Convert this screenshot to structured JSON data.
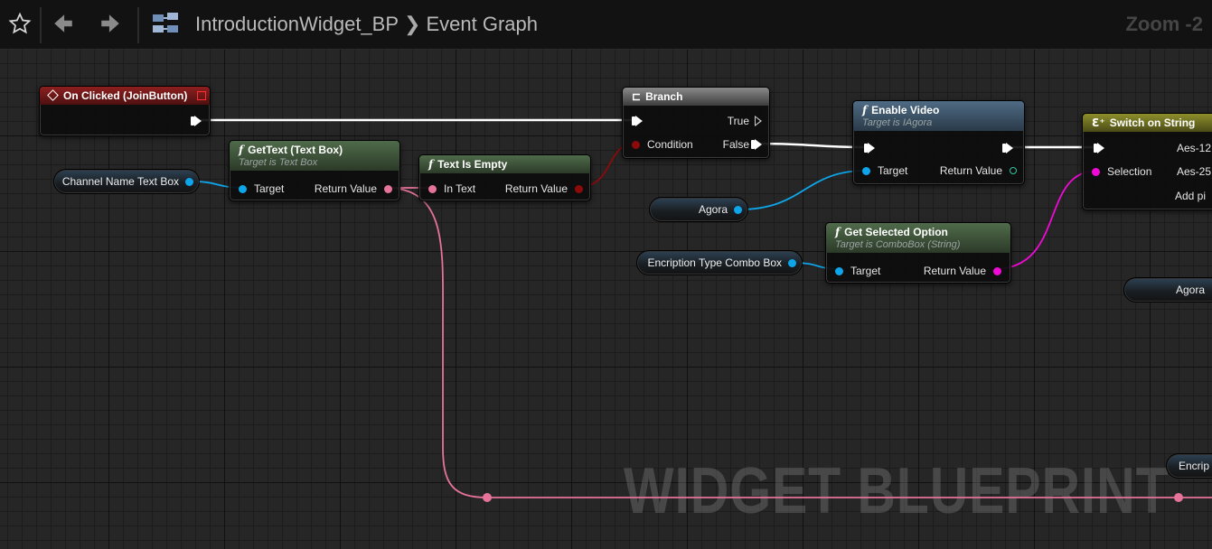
{
  "toolbar": {
    "breadcrumb_parent": "IntroductionWidget_BP",
    "breadcrumb_current": "Event Graph",
    "zoom": "Zoom -2"
  },
  "watermark": "WIDGET BLUEPRINT",
  "nodes": {
    "on_clicked": {
      "title": "On Clicked (JoinButton)"
    },
    "get_text": {
      "title": "GetText (Text Box)",
      "subtitle": "Target is Text Box",
      "pin_target": "Target",
      "pin_return": "Return Value"
    },
    "text_is_empty": {
      "title": "Text Is Empty",
      "pin_in": "In Text",
      "pin_return": "Return Value"
    },
    "branch": {
      "title": "Branch",
      "pin_condition": "Condition",
      "pin_true": "True",
      "pin_false": "False"
    },
    "enable_video": {
      "title": "Enable Video",
      "subtitle": "Target is IAgora",
      "pin_target": "Target",
      "pin_return": "Return Value"
    },
    "get_selected_option": {
      "title": "Get Selected Option",
      "subtitle": "Target is ComboBox (String)",
      "pin_target": "Target",
      "pin_return": "Return Value"
    },
    "switch_on_string": {
      "title": "Switch on String",
      "pin_selection": "Selection",
      "pin_out1": "Aes-12",
      "pin_out2": "Aes-25",
      "add_pin": "Add pi"
    }
  },
  "variables": {
    "channel_name_text_box": "Channel Name Text Box",
    "agora": "Agora",
    "encription_type_combo_box": "Encription Type Combo Box",
    "agora_right": "Agora",
    "encrip_partial": "Encrip"
  },
  "colors": {
    "object_pin": "#0ea5ea",
    "text_pin": "#e6739a",
    "bool_pin": "#8c0a0a",
    "string_pin": "#f00ad6",
    "exec_wire": "#ffffff"
  }
}
